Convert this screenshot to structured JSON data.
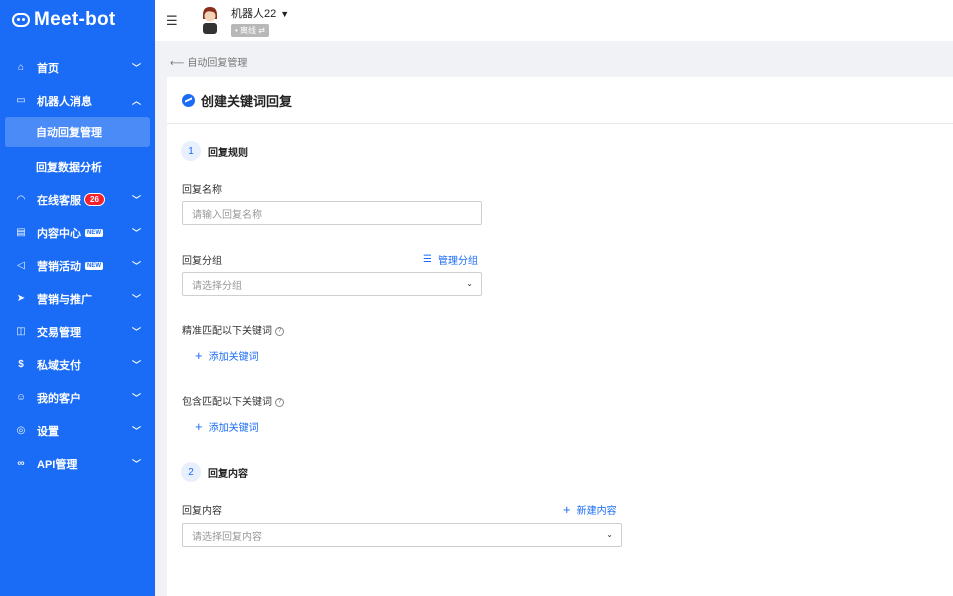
{
  "brand": {
    "logo_text": "Meet-bot"
  },
  "sidebar": {
    "items": [
      {
        "label": "首页",
        "icon": "home-icon",
        "glyph": "⌂"
      },
      {
        "label": "机器人消息",
        "icon": "chat-icon",
        "glyph": "▭",
        "expanded": true,
        "children": [
          {
            "label": "自动回复管理",
            "active": true
          },
          {
            "label": "回复数据分析",
            "active": false
          }
        ]
      },
      {
        "label": "在线客服",
        "icon": "headset-icon",
        "glyph": "◠",
        "badge": "26"
      },
      {
        "label": "内容中心",
        "icon": "content-icon",
        "glyph": "▤",
        "tag": "NEW"
      },
      {
        "label": "营销活动",
        "icon": "megaphone-icon",
        "glyph": "◁",
        "tag": "NEW"
      },
      {
        "label": "营销与推广",
        "icon": "send-icon",
        "glyph": "➤"
      },
      {
        "label": "交易管理",
        "icon": "bag-icon",
        "glyph": "◫"
      },
      {
        "label": "私域支付",
        "icon": "pay-icon",
        "glyph": "$"
      },
      {
        "label": "我的客户",
        "icon": "users-icon",
        "glyph": "☺"
      },
      {
        "label": "设置",
        "icon": "settings-icon",
        "glyph": "◎"
      },
      {
        "label": "API管理",
        "icon": "api-icon",
        "glyph": "∞"
      }
    ]
  },
  "topbar": {
    "bot_name": "机器人22",
    "status": "• 离线 ⇄"
  },
  "breadcrumb": {
    "back_label": "自动回复管理"
  },
  "page": {
    "title": "创建关键词回复"
  },
  "form": {
    "step1": {
      "num": "1",
      "label": "回复规则"
    },
    "reply_name": {
      "label": "回复名称",
      "placeholder": "请输入回复名称"
    },
    "reply_group": {
      "label": "回复分组",
      "placeholder": "请选择分组",
      "manage_link": "管理分组"
    },
    "exact_match": {
      "label": "精准匹配以下关键词",
      "add_label": "添加关键词"
    },
    "contains_match": {
      "label": "包含匹配以下关键词",
      "add_label": "添加关键词"
    },
    "step2": {
      "num": "2",
      "label": "回复内容"
    },
    "reply_content": {
      "label": "回复内容",
      "placeholder": "请选择回复内容",
      "new_link": "新建内容"
    }
  },
  "colors": {
    "primary": "#1a6cf6",
    "badge": "#f5222d"
  }
}
